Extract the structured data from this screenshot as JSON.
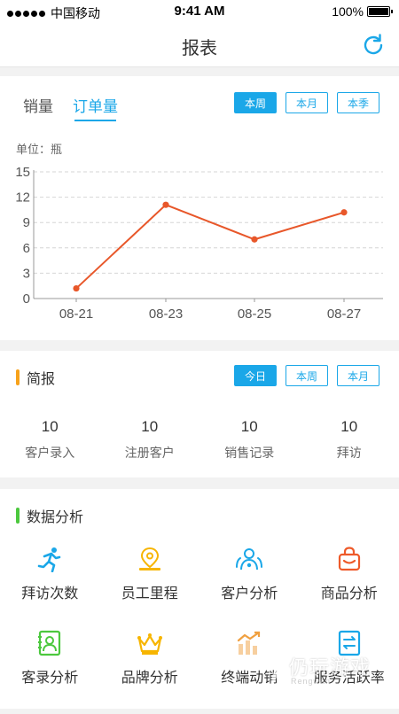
{
  "status_bar": {
    "carrier": "中国移动",
    "time": "9:41 AM",
    "battery": "100%"
  },
  "header": {
    "title": "报表"
  },
  "sales_card": {
    "tabs": [
      {
        "label": "销量",
        "active": false
      },
      {
        "label": "订单量",
        "active": true
      }
    ],
    "period_buttons": [
      {
        "label": "本周",
        "selected": true
      },
      {
        "label": "本月",
        "selected": false
      },
      {
        "label": "本季",
        "selected": false
      }
    ],
    "unit_label": "单位：瓶"
  },
  "chart_data": {
    "type": "line",
    "x": [
      "08-21",
      "08-23",
      "08-25",
      "08-27"
    ],
    "series": [
      {
        "values": [
          1.2,
          11.1,
          7.0,
          10.2
        ]
      }
    ],
    "yticks": [
      "0",
      "3",
      "6",
      "9",
      "12",
      "15"
    ],
    "ylim": [
      0,
      15
    ],
    "grid": true,
    "line_color": "#e8572a"
  },
  "brief": {
    "title": "简报",
    "accent": "#f7a21b",
    "period_buttons": [
      {
        "label": "今日",
        "selected": true
      },
      {
        "label": "本周",
        "selected": false
      },
      {
        "label": "本月",
        "selected": false
      }
    ],
    "stats": [
      {
        "value": "10",
        "label": "客户录入"
      },
      {
        "value": "10",
        "label": "注册客户"
      },
      {
        "value": "10",
        "label": "销售记录"
      },
      {
        "value": "10",
        "label": "拜访"
      }
    ]
  },
  "analysis": {
    "title": "数据分析",
    "accent": "#4cc83e",
    "items": [
      {
        "label": "拜访次数",
        "icon": "running-icon",
        "color": "#1aa7e8"
      },
      {
        "label": "员工里程",
        "icon": "location-pin-icon",
        "color": "#f7b500"
      },
      {
        "label": "客户分析",
        "icon": "users-icon",
        "color": "#1aa7e8"
      },
      {
        "label": "商品分析",
        "icon": "shopping-bag-icon",
        "color": "#ee5a2a"
      },
      {
        "label": "客录分析",
        "icon": "contact-card-icon",
        "color": "#4cc83e"
      },
      {
        "label": "品牌分析",
        "icon": "crown-icon",
        "color": "#f7b500"
      },
      {
        "label": "终端动销",
        "icon": "trend-chart-icon",
        "color": "#f0a040"
      },
      {
        "label": "服务活跃率",
        "icon": "exchange-doc-icon",
        "color": "#1aa7e8"
      }
    ]
  },
  "watermark": {
    "text": "仍玩游戏",
    "subtext": "Rengwan"
  },
  "colors": {
    "primary": "#1aa7e8",
    "background": "#f2f2f2"
  }
}
